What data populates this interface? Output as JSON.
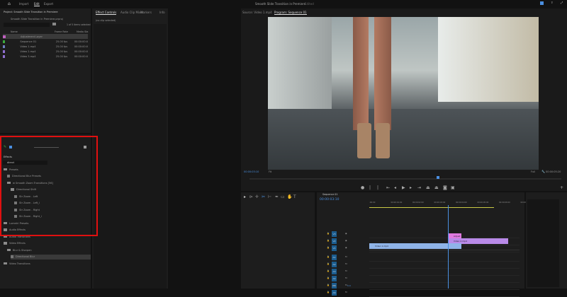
{
  "topbar": {
    "home": "home-icon",
    "tabs": [
      "Import",
      "Edit",
      "Export"
    ],
    "active": "Edit",
    "title": "Smooth Slide Transition in Premiere",
    "status": "Edited"
  },
  "project": {
    "title": "Project: Smooth Slide Transition in Premiere",
    "file": "Smooth Slide Transition in Premiere.prproj",
    "selection": "1 of 5 items selected",
    "columns": [
      "Name",
      "Frame Rate",
      "Media Sta"
    ],
    "items": [
      {
        "name": "Adjustment Layer",
        "rate": "",
        "start": "",
        "color": "#c060c0"
      },
      {
        "name": "Sequence 01",
        "rate": "25.00 fps",
        "start": "00:00:00:0",
        "color": "#3caa3c"
      },
      {
        "name": "Video 1.mp4",
        "rate": "25.00 fps",
        "start": "00:00:00:0",
        "color": "#6f7fc0"
      },
      {
        "name": "Video 2.mp4",
        "rate": "25.00 fps",
        "start": "00:00:00:0",
        "color": "#8f6fd0"
      },
      {
        "name": "Video 3.mp4",
        "rate": "25.00 fps",
        "start": "00:00:00:0",
        "color": "#8f6fd0"
      }
    ]
  },
  "effect_controls": {
    "tabs": [
      "Effect Controls",
      "Audio Clip Mixer",
      "Markers",
      "Info"
    ],
    "active": "Effect Controls",
    "empty": "(no clip selected)"
  },
  "effects": {
    "title": "Effects",
    "search": "direct",
    "tree": [
      {
        "label": "Presets",
        "depth": 0,
        "type": "folder"
      },
      {
        "label": "Directional Blur Presets",
        "depth": 1,
        "type": "item"
      },
      {
        "label": "w Smooth Zoom Transitions [56]",
        "depth": 1,
        "type": "folder"
      },
      {
        "label": "Directional Shift",
        "depth": 2,
        "type": "folder"
      },
      {
        "label": "Str Zoom - Left",
        "depth": 3,
        "type": "item"
      },
      {
        "label": "Str Zoom - Left_i",
        "depth": 3,
        "type": "item"
      },
      {
        "label": "Str Zoom - Right",
        "depth": 3,
        "type": "item"
      },
      {
        "label": "Str Zoom - Right_i",
        "depth": 3,
        "type": "item"
      },
      {
        "label": "Lumetri Presets",
        "depth": 0,
        "type": "folder"
      },
      {
        "label": "Audio Effects",
        "depth": 0,
        "type": "folder"
      },
      {
        "label": "Audio Transitions",
        "depth": 0,
        "type": "folder"
      },
      {
        "label": "Video Effects",
        "depth": 0,
        "type": "folder"
      },
      {
        "label": "Blur & Sharpen",
        "depth": 1,
        "type": "folder"
      },
      {
        "label": "Directional Blur",
        "depth": 2,
        "type": "item",
        "selected": true
      },
      {
        "label": "Video Transitions",
        "depth": 0,
        "type": "folder"
      }
    ],
    "highlight_color": "#e01010"
  },
  "source_monitor": {
    "tab": "Source: Video 1.mp4"
  },
  "program_monitor": {
    "tab": "Program: Sequence 01",
    "timecode": "00:00:03:10",
    "fit": "Fit",
    "quality": "Full",
    "duration": "00:00:05:20",
    "playhead_fraction": 0.6
  },
  "timeline": {
    "tab": "Sequence 01",
    "timecode": "00:00:03:10",
    "ruler": [
      ":00:00",
      "00:00:01:00",
      "00:00:02:00",
      "00:00:03:00",
      "00:00:04:00",
      "00:00:05:00",
      "00:00:06:00",
      "00:00"
    ],
    "video_tracks": [
      "V3",
      "V2",
      "V1"
    ],
    "audio_tracks": [
      "A1",
      "A2",
      "A3",
      "A4",
      "A5",
      "A6"
    ],
    "mix": "Mix",
    "mix_value": "0.0",
    "clips": [
      {
        "name": "Adjust",
        "track": "V3",
        "color": "#e07ae0"
      },
      {
        "name": "Video 2.mp4",
        "track": "V2",
        "color": "#b98ae8"
      },
      {
        "name": "Video 1.mp4",
        "track": "V1",
        "color": "#8fb4e8"
      }
    ],
    "playhead_color": "#4a8fe0"
  }
}
